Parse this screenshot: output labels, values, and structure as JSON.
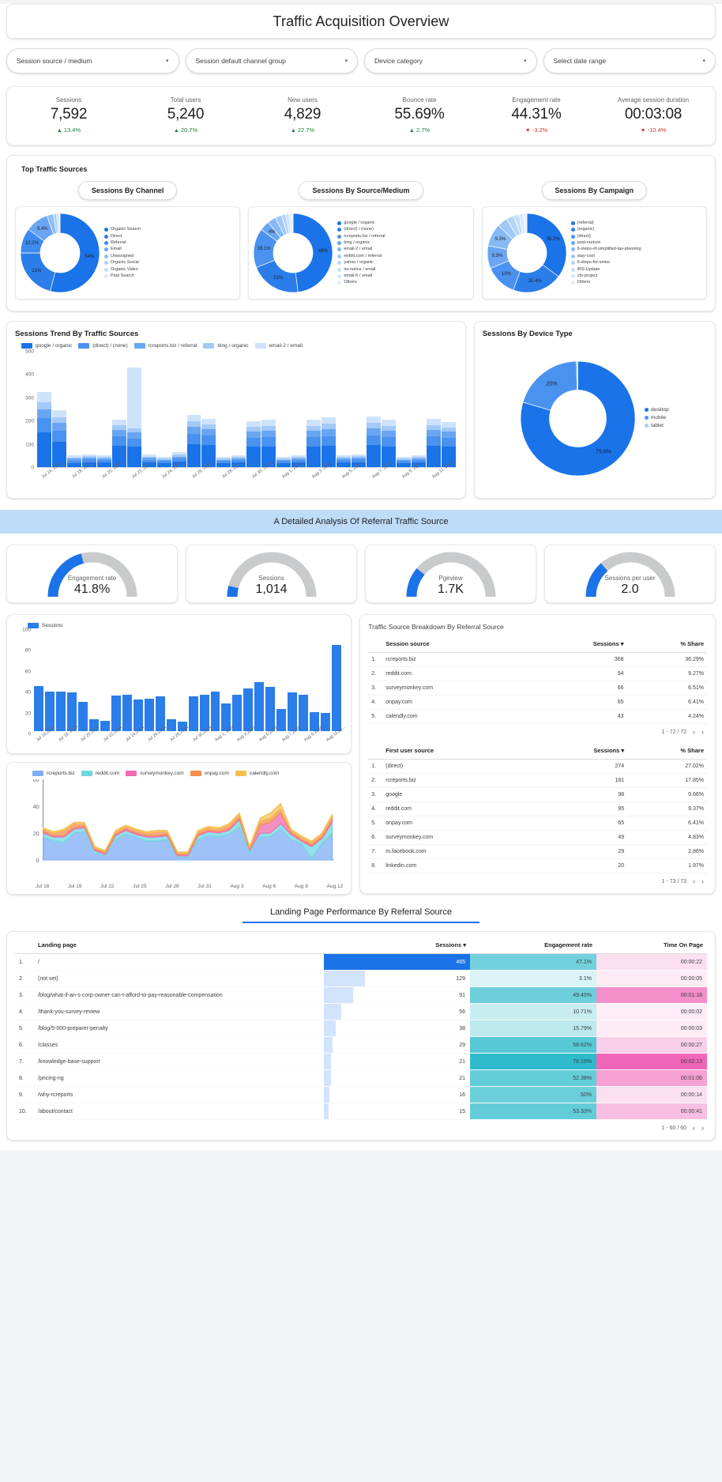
{
  "header": {
    "title": "Traffic Acquisition Overview"
  },
  "filters": [
    {
      "label": "Session source / medium",
      "icon": "chevron-down-icon"
    },
    {
      "label": "Session default channel group",
      "icon": "chevron-down-icon"
    },
    {
      "label": "Device category",
      "icon": "chevron-down-icon"
    },
    {
      "label": "Select date range",
      "icon": "chevron-down-icon"
    }
  ],
  "scorecards": [
    {
      "label": "Sessions",
      "value": "7,592",
      "delta": "13.4%",
      "dir": "up"
    },
    {
      "label": "Total users",
      "value": "5,240",
      "delta": "20.7%",
      "dir": "up"
    },
    {
      "label": "New users",
      "value": "4,829",
      "delta": "22.7%",
      "dir": "up"
    },
    {
      "label": "Bounce rate",
      "value": "55.69%",
      "delta": "2.7%",
      "dir": "up"
    },
    {
      "label": "Engagement rate",
      "value": "44.31%",
      "delta": "-3.2%",
      "dir": "down"
    },
    {
      "label": "Average session duration",
      "value": "00:03:08",
      "delta": "-10.4%",
      "dir": "down"
    }
  ],
  "top_sources": {
    "title": "Top Traffic Sources",
    "tabs": [
      {
        "label": "Sessions By Channel"
      },
      {
        "label": "Sessions By Source/Medium"
      },
      {
        "label": "Sessions By Campaign"
      }
    ]
  },
  "chart_data": [
    {
      "id": "sessions_by_channel",
      "type": "pie",
      "title": "Sessions By Channel",
      "labels": [
        "Organic Search",
        "Direct",
        "Referral",
        "Email",
        "Unassigned",
        "Organic Social",
        "Organic Video",
        "Paid Search"
      ],
      "values": [
        54,
        21,
        10.2,
        9.4,
        2.6,
        1.4,
        0.9,
        0.5
      ],
      "shown_labels": [
        "54%",
        "21%",
        "10.2%",
        "9.4%"
      ],
      "colors": [
        "#1a73e8",
        "#2b7de9",
        "#3d8bf0",
        "#69a5f2",
        "#8fbdf6",
        "#aed0f8",
        "#c8dffa",
        "#dbe9fc"
      ]
    },
    {
      "id": "sessions_by_source_medium",
      "type": "pie",
      "title": "Sessions By Source/Medium",
      "labels": [
        "google / organic",
        "(direct) / (none)",
        "rcreports.biz / referral",
        "bing / organic",
        "email-2 / email",
        "reddit.com / referral",
        "yahoo / organic",
        "irs-notice / email",
        "email-5 / email",
        "Others"
      ],
      "values": [
        48,
        21,
        16.1,
        4,
        3.5,
        2.6,
        1.8,
        1.2,
        0.9,
        0.9
      ],
      "shown_labels": [
        "48%",
        "21%",
        "16.1%",
        "4%"
      ],
      "colors": [
        "#1a73e8",
        "#2b7de9",
        "#4a92f0",
        "#69a5f2",
        "#86b9f5",
        "#9fc9f7",
        "#b5d5f9",
        "#c8dffa",
        "#d7e7fb",
        "#e6eefd"
      ]
    },
    {
      "id": "sessions_by_campaign",
      "type": "pie",
      "title": "Sessions By Campaign",
      "labels": [
        "(referral)",
        "(organic)",
        "(direct)",
        "post-nurture",
        "6-steps-of-simplified-tax-planning",
        "stay-cool",
        "6-steps-for-smbs",
        "IRS-Update",
        "cfo-project",
        "Others"
      ],
      "values": [
        35.2,
        20.4,
        13,
        9.3,
        9.3,
        4.2,
        3.1,
        2.3,
        1.7,
        1.5
      ],
      "shown_labels": [
        "35.2%",
        "20.4%",
        "13%",
        "9.3%",
        "9.3%"
      ],
      "colors": [
        "#1a73e8",
        "#2b7de9",
        "#4a92f0",
        "#69a5f2",
        "#86b9f5",
        "#9fc9f7",
        "#b5d5f9",
        "#c8dffa",
        "#d7e7fb",
        "#e6eefd"
      ]
    },
    {
      "id": "sessions_trend_by_traffic_sources",
      "type": "bar",
      "stacked": true,
      "title": "Sessions Trend By Traffic Sources",
      "ylabel": "",
      "ylim": [
        0,
        500
      ],
      "yticks": [
        0,
        100,
        200,
        300,
        400,
        500
      ],
      "series": [
        {
          "name": "google / organic",
          "color": "#1a73e8",
          "values": [
            150,
            110,
            18,
            22,
            20,
            92,
            88,
            22,
            18,
            24,
            100,
            95,
            18,
            20,
            88,
            90,
            18,
            20,
            90,
            92,
            20,
            22,
            95,
            90,
            18,
            20,
            92,
            88
          ]
        },
        {
          "name": "(direct) / (none)",
          "color": "#4a92f0",
          "values": [
            60,
            48,
            10,
            12,
            10,
            40,
            36,
            10,
            8,
            12,
            44,
            40,
            8,
            10,
            38,
            40,
            8,
            10,
            40,
            42,
            10,
            12,
            42,
            40,
            8,
            10,
            40,
            38
          ]
        },
        {
          "name": "rcreports.biz / referral",
          "color": "#69a5f2",
          "values": [
            40,
            32,
            8,
            8,
            8,
            28,
            26,
            8,
            6,
            10,
            30,
            28,
            6,
            8,
            26,
            28,
            6,
            8,
            28,
            30,
            8,
            8,
            30,
            28,
            6,
            8,
            28,
            26
          ]
        },
        {
          "name": "bing / organic",
          "color": "#a3c9f7",
          "values": [
            30,
            24,
            6,
            6,
            6,
            20,
            18,
            6,
            6,
            8,
            22,
            20,
            6,
            6,
            20,
            20,
            6,
            6,
            20,
            22,
            6,
            6,
            22,
            20,
            6,
            6,
            20,
            18
          ]
        },
        {
          "name": "email-2 / email",
          "color": "#cfe2fb",
          "values": [
            45,
            30,
            8,
            8,
            8,
            25,
            260,
            10,
            8,
            12,
            28,
            26,
            8,
            8,
            24,
            26,
            8,
            8,
            26,
            28,
            8,
            8,
            28,
            26,
            8,
            8,
            26,
            24
          ]
        }
      ],
      "x": [
        "Jul 16, 2024",
        "Jul 17, 2024",
        "Jul 18, 2024",
        "Jul 19, 2024",
        "Jul 20, 2024",
        "Jul 21, 2024",
        "Jul 22, 2024",
        "Jul 23, 2024",
        "Jul 24, 2024",
        "Jul 25, 2024",
        "Jul 26, 2024",
        "Jul 27, 2024",
        "Jul 28, 2024",
        "Jul 29, 2024",
        "Jul 30, 2024",
        "Jul 31, 2024",
        "Aug 1, 2024",
        "Aug 2, 2024",
        "Aug 3, 2024",
        "Aug 4, 2024",
        "Aug 5, 2024",
        "Aug 6, 2024",
        "Aug 7, 2024",
        "Aug 8, 2024",
        "Aug 9, 2024",
        "Aug 10, 2024",
        "Aug 11, 2024",
        "Aug 12, 2024"
      ],
      "xticks": [
        "Jul 16, 2024",
        "Jul 18, 2024",
        "Jul 20, 2024",
        "Jul 22, 2024",
        "Jul 24, 2024",
        "Jul 26, 2024",
        "Jul 28, 2024",
        "Jul 30, 2024",
        "Aug 1, 2024",
        "Aug 3, 2024",
        "Aug 5, 2024",
        "Aug 7, 2024",
        "Aug 9, 2024",
        "Aug 11, 2024"
      ]
    },
    {
      "id": "sessions_by_device_type",
      "type": "pie",
      "title": "Sessions By Device Type",
      "labels": [
        "desktop",
        "mobile",
        "tablet"
      ],
      "values": [
        79.6,
        20,
        0.4
      ],
      "shown_labels": [
        "79.6%",
        "20%"
      ],
      "colors": [
        "#1a73e8",
        "#4a92f0",
        "#a3c9f7"
      ]
    },
    {
      "id": "referral_sessions_bar",
      "type": "bar",
      "title": "Sessions",
      "ylim": [
        0,
        100
      ],
      "yticks": [
        0,
        20,
        40,
        60,
        80,
        100
      ],
      "series": [
        {
          "name": "Sessions",
          "color": "#2b7de9",
          "values": [
            47,
            41,
            41,
            40,
            30,
            12,
            11,
            37,
            38,
            33,
            34,
            36,
            12,
            10,
            36,
            38,
            41,
            29,
            38,
            44,
            51,
            46,
            23,
            40,
            38,
            20,
            19,
            89
          ]
        }
      ],
      "xticks": [
        "Jul 16,2024",
        "Jul 18, 2024",
        "Jul 20,2024",
        "Jul 22,2024",
        "Jul 24,2024",
        "Jul 26,2024",
        "Jul 28,2024",
        "Jul 30,2024",
        "Aug 1, 2024",
        "Aug 3,2024",
        "Aug 5,2024",
        "Aug 7,2024",
        "Aug 9,2024",
        "Aug 11,20..."
      ]
    },
    {
      "id": "referral_sources_area",
      "type": "area",
      "stacked": true,
      "ylim": [
        0,
        60
      ],
      "yticks": [
        0,
        20,
        40,
        60
      ],
      "xticks": [
        "Jul 16",
        "Jul 19",
        "Jul 22",
        "Jul 25",
        "Jul 28",
        "Jul 31",
        "Aug 3",
        "Aug 6",
        "Aug 9",
        "Aug 12"
      ],
      "series": [
        {
          "name": "rcreports.biz",
          "color": "#7eaef5",
          "values": [
            17,
            14,
            13,
            20,
            21,
            5,
            3,
            15,
            19,
            17,
            14,
            14,
            15,
            2,
            2,
            15,
            18,
            17,
            19,
            24,
            5,
            17,
            17,
            23,
            15,
            12,
            1,
            12,
            20
          ]
        },
        {
          "name": "reddit.com",
          "color": "#6fd6e0",
          "values": [
            3,
            3,
            4,
            3,
            3,
            2,
            1,
            3,
            3,
            2,
            3,
            3,
            3,
            1,
            1,
            3,
            3,
            3,
            3,
            6,
            2,
            3,
            3,
            4,
            4,
            2,
            9,
            4,
            8
          ]
        },
        {
          "name": "surveymonkey.com",
          "color": "#f06ab0",
          "values": [
            1,
            1,
            1,
            1,
            1,
            1,
            1,
            1,
            1,
            1,
            1,
            1,
            1,
            1,
            1,
            1,
            1,
            1,
            1,
            1,
            1,
            6,
            8,
            8,
            1,
            1,
            1,
            1,
            2
          ]
        },
        {
          "name": "onpay.com",
          "color": "#f58d4e",
          "values": [
            2,
            2,
            4,
            3,
            2,
            1,
            1,
            2,
            2,
            2,
            2,
            3,
            2,
            1,
            1,
            2,
            2,
            2,
            3,
            3,
            1,
            3,
            3,
            3,
            2,
            2,
            2,
            2,
            3
          ]
        },
        {
          "name": "calendly.com",
          "color": "#f5bf4e",
          "values": [
            1,
            1,
            1,
            1,
            1,
            1,
            1,
            1,
            1,
            1,
            1,
            1,
            1,
            1,
            1,
            1,
            1,
            1,
            1,
            1,
            1,
            2,
            4,
            4,
            1,
            1,
            1,
            1,
            1
          ]
        }
      ]
    }
  ],
  "trend": {
    "title": "Sessions Trend By Traffic Sources"
  },
  "device": {
    "title": "Sessions By Device Type"
  },
  "section_banner": {
    "title": "A Detailed Analysis Of Referral Traffic Source"
  },
  "gauges": [
    {
      "label": "Engagement rate",
      "value": "41.8%",
      "pct": 41.8
    },
    {
      "label": "Sessions",
      "value": "1,014",
      "pct": 8
    },
    {
      "label": "Pgeview",
      "value": "1.7K",
      "pct": 22
    },
    {
      "label": "Sessions per user",
      "value": "2.0",
      "pct": 27
    }
  ],
  "breakdown": {
    "title": "Traffic Source Breakdown By Referral Source",
    "table1": {
      "columns": [
        "Session source",
        "Sessions",
        "% Share"
      ],
      "sort_col": "Sessions",
      "rows": [
        {
          "n": "1.",
          "source": "rcreports.biz",
          "sessions": "368",
          "share": "36.29%"
        },
        {
          "n": "2.",
          "source": "reddit.com",
          "sessions": "94",
          "share": "9.27%"
        },
        {
          "n": "3.",
          "source": "surveymonkey.com",
          "sessions": "66",
          "share": "6.51%"
        },
        {
          "n": "4.",
          "source": "onpay.com",
          "sessions": "65",
          "share": "6.41%"
        },
        {
          "n": "5.",
          "source": "calendly.com",
          "sessions": "43",
          "share": "4.24%"
        }
      ],
      "pager": "1 - 72 / 72"
    },
    "table2": {
      "columns": [
        "First user source",
        "Sessions",
        "% Share"
      ],
      "sort_col": "Sessions",
      "rows": [
        {
          "n": "1.",
          "source": "(direct)",
          "sessions": "274",
          "share": "27.02%"
        },
        {
          "n": "2.",
          "source": "rcreports.biz",
          "sessions": "181",
          "share": "17.85%"
        },
        {
          "n": "3.",
          "source": "google",
          "sessions": "98",
          "share": "9.66%"
        },
        {
          "n": "4.",
          "source": "reddit.com",
          "sessions": "95",
          "share": "9.37%"
        },
        {
          "n": "5.",
          "source": "onpay.com",
          "sessions": "65",
          "share": "6.41%"
        },
        {
          "n": "6.",
          "source": "surveymonkey.com",
          "sessions": "49",
          "share": "4.83%"
        },
        {
          "n": "7.",
          "source": "m.facebook.com",
          "sessions": "29",
          "share": "2.86%"
        },
        {
          "n": "8.",
          "source": "linkedin.com",
          "sessions": "20",
          "share": "1.97%"
        }
      ],
      "pager": "1 - 73 / 73"
    }
  },
  "landing": {
    "title": "Landing Page Performance By Referral Source",
    "columns": [
      "Landing page",
      "Sessions",
      "Engagement rate",
      "Time On Page"
    ],
    "sort_col": "Sessions",
    "rows": [
      {
        "n": "1.",
        "page": "/",
        "sessions": "465",
        "bar": 100,
        "er": "47.1%",
        "er_w": 62,
        "time": "00:00:22",
        "t_w": 12
      },
      {
        "n": "2.",
        "page": "(not set)",
        "sessions": "129",
        "bar": 28,
        "er": "3.1%",
        "er_w": 4,
        "time": "00:00:05",
        "t_w": 3
      },
      {
        "n": "3.",
        "page": "/blog/what-if-an-s-corp-owner-can-t-afford-to-pay-reasonable-compensation",
        "sessions": "91",
        "bar": 20,
        "er": "49.45%",
        "er_w": 65,
        "time": "00:01:18",
        "t_w": 70
      },
      {
        "n": "4.",
        "page": "/thank-you-survey-review",
        "sessions": "56",
        "bar": 12,
        "er": "10.71%",
        "er_w": 14,
        "time": "00:00:02",
        "t_w": 2
      },
      {
        "n": "5.",
        "page": "/blog/5-000-preparer-penalty",
        "sessions": "38",
        "bar": 8,
        "er": "15.79%",
        "er_w": 21,
        "time": "00:00:03",
        "t_w": 3
      },
      {
        "n": "6.",
        "page": "/classes",
        "sessions": "29",
        "bar": 6,
        "er": "58.62%",
        "er_w": 77,
        "time": "00:00:27",
        "t_w": 24
      },
      {
        "n": "7.",
        "page": "/knowledge-base-support",
        "sessions": "21",
        "bar": 5,
        "er": "76.19%",
        "er_w": 100,
        "time": "00:02:13",
        "t_w": 100
      },
      {
        "n": "8.",
        "page": "/pricing-ng",
        "sessions": "21",
        "bar": 5,
        "er": "52.38%",
        "er_w": 69,
        "time": "00:01:06",
        "t_w": 58
      },
      {
        "n": "9.",
        "page": "/why-rcreports",
        "sessions": "16",
        "bar": 4,
        "er": "50%",
        "er_w": 66,
        "time": "00:00:14",
        "t_w": 12
      },
      {
        "n": "10.",
        "page": "/about/contact",
        "sessions": "15",
        "bar": 3,
        "er": "53.33%",
        "er_w": 70,
        "time": "00:00:41",
        "t_w": 35
      }
    ],
    "pager": "1 - 60 / 60"
  },
  "colors": {
    "accent": "#1a73e8",
    "up": "#188038",
    "down": "#d93025",
    "banner": "#bedcf8",
    "gauge_track": "#c8cacc"
  }
}
